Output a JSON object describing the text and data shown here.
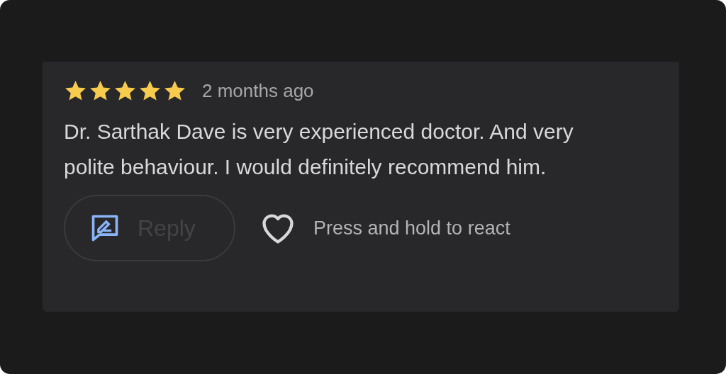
{
  "review": {
    "stars": 5,
    "time": "2 months ago",
    "text": "Dr. Sarthak Dave is very experienced doctor. And very polite behaviour. I would definitely recommend him.",
    "reply_button": "Reply",
    "react_hint": "Press and hold to react"
  }
}
